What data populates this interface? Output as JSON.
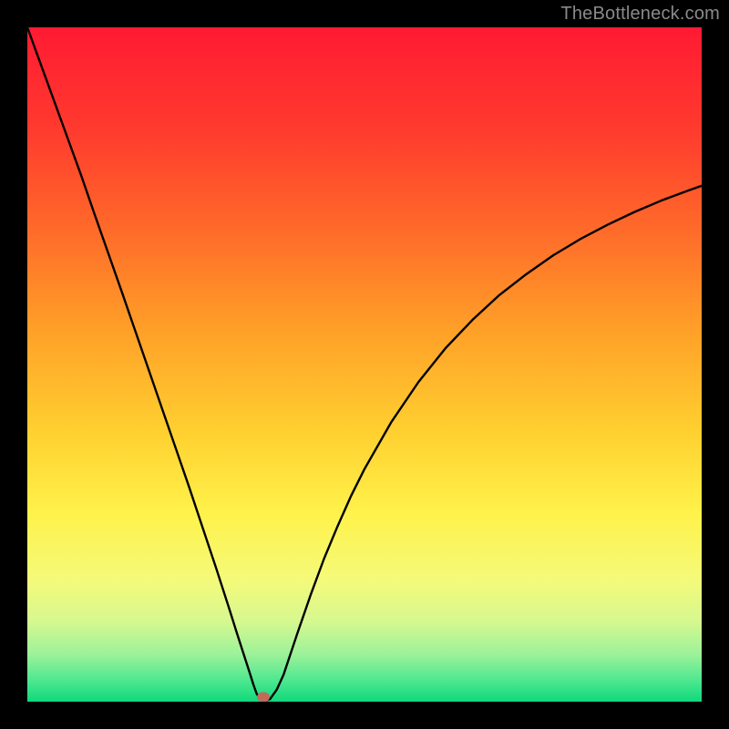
{
  "attribution": "TheBottleneck.com",
  "chart_data": {
    "type": "line",
    "title": "",
    "xlabel": "",
    "ylabel": "",
    "xlim": [
      0,
      1
    ],
    "ylim": [
      0,
      1
    ],
    "x": [
      0.0,
      0.02,
      0.04,
      0.06,
      0.08,
      0.1,
      0.12,
      0.14,
      0.16,
      0.18,
      0.2,
      0.22,
      0.24,
      0.26,
      0.28,
      0.3,
      0.31,
      0.32,
      0.33,
      0.335,
      0.34,
      0.345,
      0.35,
      0.36,
      0.37,
      0.38,
      0.4,
      0.42,
      0.44,
      0.46,
      0.48,
      0.5,
      0.54,
      0.58,
      0.62,
      0.66,
      0.7,
      0.74,
      0.78,
      0.82,
      0.86,
      0.9,
      0.94,
      0.98,
      1.0
    ],
    "values": [
      1.0,
      0.945,
      0.89,
      0.835,
      0.78,
      0.722,
      0.665,
      0.608,
      0.55,
      0.492,
      0.434,
      0.376,
      0.318,
      0.258,
      0.198,
      0.136,
      0.104,
      0.073,
      0.042,
      0.026,
      0.012,
      0.004,
      0.0,
      0.004,
      0.018,
      0.04,
      0.1,
      0.158,
      0.212,
      0.26,
      0.305,
      0.345,
      0.415,
      0.474,
      0.524,
      0.566,
      0.603,
      0.634,
      0.662,
      0.686,
      0.707,
      0.726,
      0.743,
      0.758,
      0.765
    ],
    "marker": {
      "x": 0.35,
      "y": 0.0,
      "color": "#c36a5a"
    },
    "gradient_stops": [
      {
        "offset": 0.0,
        "color": "#ff1a33"
      },
      {
        "offset": 0.15,
        "color": "#ff3a2e"
      },
      {
        "offset": 0.3,
        "color": "#ff6a2a"
      },
      {
        "offset": 0.45,
        "color": "#ffa028"
      },
      {
        "offset": 0.6,
        "color": "#ffd030"
      },
      {
        "offset": 0.72,
        "color": "#fff24a"
      },
      {
        "offset": 0.82,
        "color": "#f4fa7a"
      },
      {
        "offset": 0.88,
        "color": "#d7f88f"
      },
      {
        "offset": 0.93,
        "color": "#9cf29a"
      },
      {
        "offset": 0.97,
        "color": "#4be78f"
      },
      {
        "offset": 1.0,
        "color": "#0fd97a"
      }
    ]
  }
}
